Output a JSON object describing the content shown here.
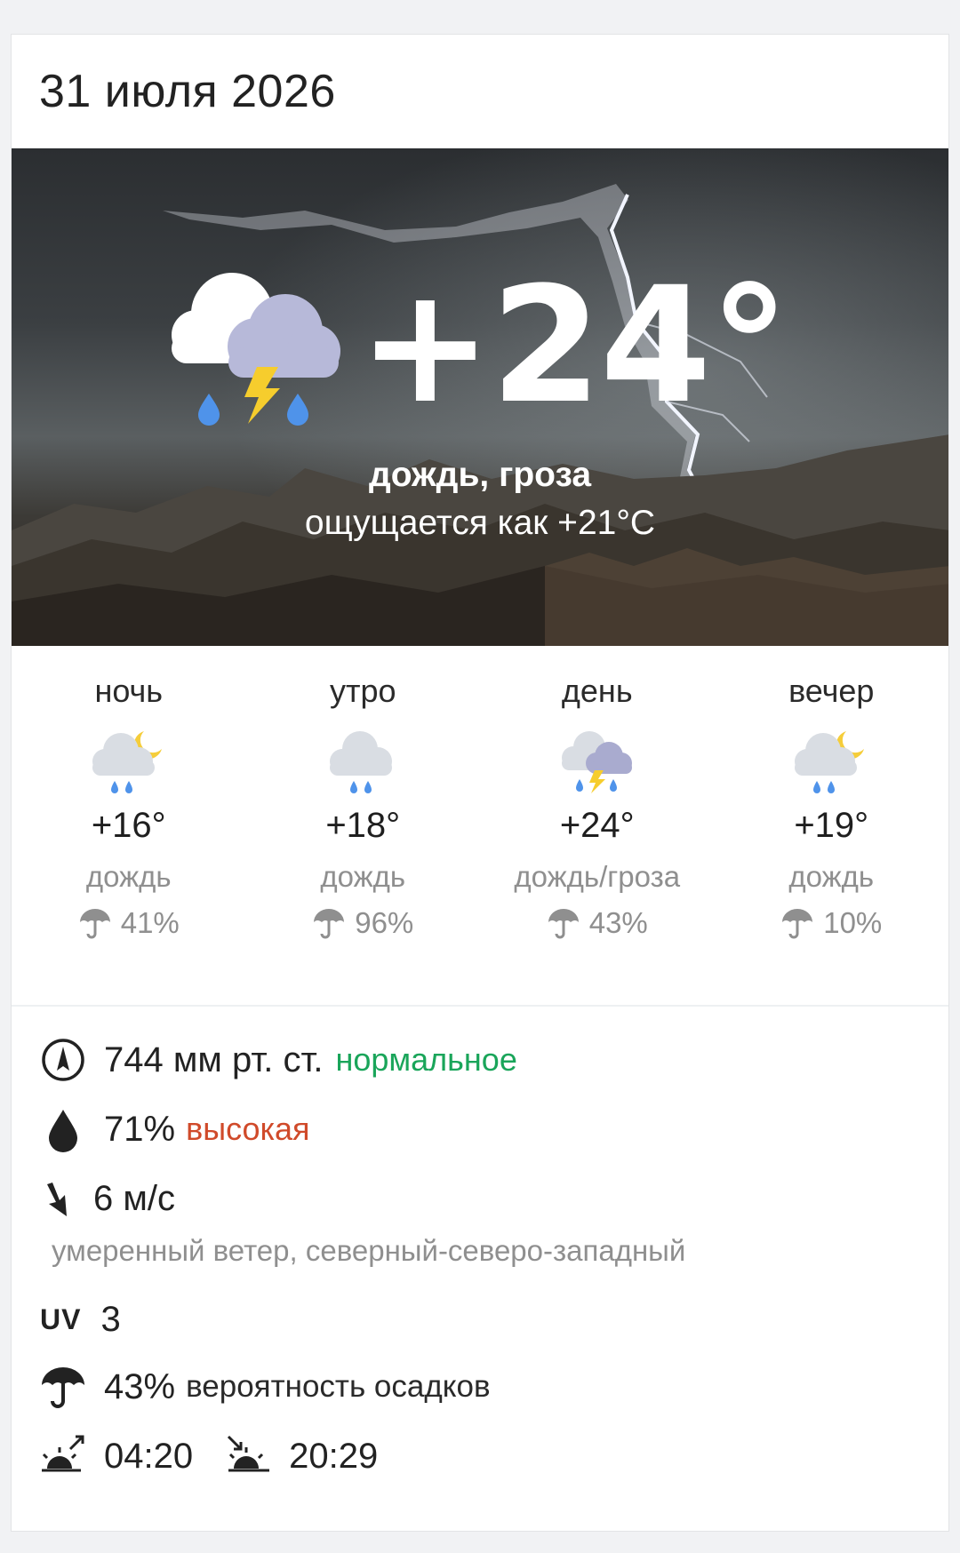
{
  "header": {
    "date": "31 июля 2026"
  },
  "current": {
    "icon": "cloud-rain-thunder-icon",
    "temperature": "+24°",
    "condition": "дождь, гроза",
    "feels_like": "ощущается как +21°C"
  },
  "parts": [
    {
      "name": "ночь",
      "icon": "cloud-moon-rain-icon",
      "temp": "+16°",
      "condition": "дождь",
      "precip": "41%"
    },
    {
      "name": "утро",
      "icon": "cloud-rain-icon",
      "temp": "+18°",
      "condition": "дождь",
      "precip": "96%"
    },
    {
      "name": "день",
      "icon": "cloud-rain-thunder-icon",
      "temp": "+24°",
      "condition": "дождь/гроза",
      "precip": "43%"
    },
    {
      "name": "вечер",
      "icon": "cloud-moon-rain-icon",
      "temp": "+19°",
      "condition": "дождь",
      "precip": "10%"
    }
  ],
  "details": {
    "pressure": {
      "value": "744 мм рт. ст.",
      "note": "нормальное",
      "note_color": "#1aa55a"
    },
    "humidity": {
      "value": "71%",
      "note": "высокая",
      "note_color": "#d04a2a"
    },
    "wind": {
      "value": "6 м/с",
      "description": "умеренный ветер, северный-северо-западный"
    },
    "uv": {
      "label": "UV",
      "value": "3"
    },
    "precipitation": {
      "value": "43%",
      "note": "вероятность осадков"
    },
    "sunrise": "04:20",
    "sunset": "20:29"
  }
}
